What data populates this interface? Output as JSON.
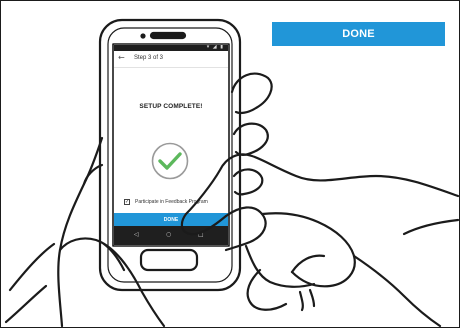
{
  "callout": {
    "done_label": "DONE"
  },
  "phone": {
    "status_icons": "▾ ◢ ▮",
    "back_glyph": "←",
    "step_label": "Step 3 of 3",
    "title": "SETUP COMPLETE!",
    "feedback_check_glyph": "✓",
    "feedback_label": "Participate in Feedback Program",
    "done_label": "DONE",
    "nav": {
      "back": "◁",
      "home": "○",
      "recent": "□"
    }
  },
  "colors": {
    "accent": "#2196d8",
    "success": "#5cb85c",
    "outline": "#1b1b1b"
  }
}
